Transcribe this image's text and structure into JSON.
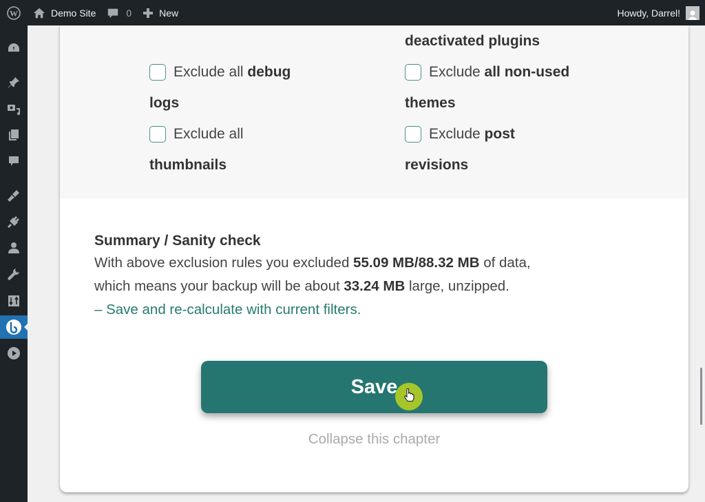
{
  "admin_bar": {
    "logo_icon": "wordpress-logo-icon",
    "site_name": "Demo Site",
    "comments_count": "0",
    "new_label": "New",
    "greeting": "Howdy, Darrel!"
  },
  "sidebar": {
    "items": [
      {
        "icon": "dashboard-icon",
        "active": false
      },
      {
        "icon": "posts-pin-icon",
        "active": false
      },
      {
        "icon": "media-icon",
        "active": false
      },
      {
        "icon": "pages-icon",
        "active": false
      },
      {
        "icon": "comments-icon",
        "active": false
      },
      {
        "icon": "appearance-brush-icon",
        "active": false
      },
      {
        "icon": "plugins-icon",
        "active": false
      },
      {
        "icon": "users-icon",
        "active": false
      },
      {
        "icon": "tools-wrench-icon",
        "active": false
      },
      {
        "icon": "settings-sliders-icon",
        "active": false
      },
      {
        "icon": "backup-plugin-icon",
        "active": true
      },
      {
        "icon": "video-play-icon",
        "active": false
      }
    ]
  },
  "options": {
    "col2_overflow": "deactivated plugins",
    "items": [
      {
        "prefix": "Exclude all ",
        "bold": "debug",
        "continuation": "logs",
        "checked": false
      },
      {
        "prefix": "Exclude ",
        "bold": "all non-used",
        "continuation": "themes",
        "checked": false
      },
      {
        "prefix": "Exclude all",
        "bold": "",
        "continuation": "thumbnails",
        "checked": false
      },
      {
        "prefix": "Exclude ",
        "bold": "post",
        "continuation": "revisions",
        "checked": false
      }
    ]
  },
  "summary": {
    "heading": "Summary / Sanity check",
    "line1_prefix": "With above exclusion rules you excluded ",
    "excluded_size": "55.09 MB/88.32 MB",
    "line1_suffix": " of data,",
    "line2_prefix": "which means your backup will be about ",
    "backup_size": "33.24 MB",
    "line2_suffix": " large, unzipped.",
    "recalc_link": "– Save and re-calculate with current filters."
  },
  "save_label": "Save",
  "collapse_label": "Collapse this chapter",
  "colors": {
    "accent": "#257670",
    "link": "#267a6e",
    "admin_bar": "#1d2327",
    "sidebar_active": "#2271b1",
    "cursor_highlight": "#b1cc24"
  }
}
